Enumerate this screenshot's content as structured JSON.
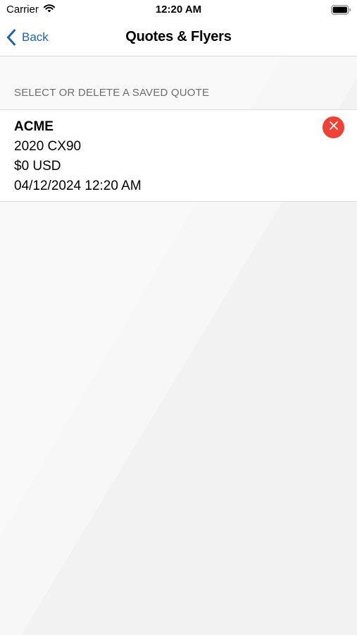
{
  "status_bar": {
    "carrier": "Carrier",
    "time": "12:20 AM"
  },
  "nav": {
    "back_label": "Back",
    "title": "Quotes & Flyers"
  },
  "section": {
    "header": "SELECT OR DELETE A SAVED QUOTE"
  },
  "quotes": [
    {
      "company": "ACME",
      "vehicle": "2020 CX90",
      "price": "$0 USD",
      "datetime": "04/12/2024 12:20 AM"
    }
  ],
  "colors": {
    "accent": "#1e64a8",
    "delete": "#ef4135",
    "background": "#f2f2f2"
  },
  "icons": {
    "wifi": "wifi-icon",
    "battery": "battery-icon",
    "back": "chevron-left-icon",
    "delete": "close-icon"
  }
}
